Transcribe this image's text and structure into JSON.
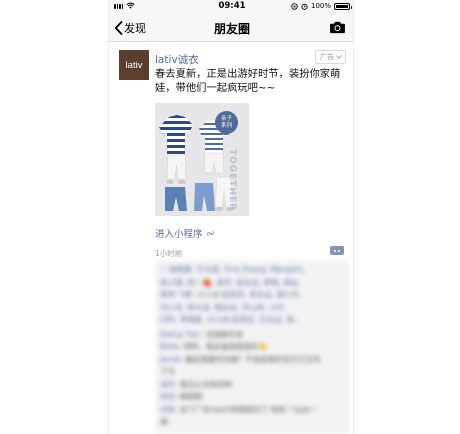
{
  "status_bar": {
    "time": "09:41",
    "battery_text": "100%",
    "battery_level": 1.0
  },
  "nav": {
    "back_label": "发现",
    "title": "朋友圈",
    "right_icon": "camera-icon"
  },
  "post": {
    "avatar_text": "lativ",
    "author": "lativ诚衣",
    "ad_label": "广告",
    "text": "春去夏新，正是出游好时节，装扮你家萌娃，带他们一起疯玩吧~~",
    "image": {
      "badge_line1": "亲子",
      "badge_line2": "系列",
      "vertical_text": "TOGETHER"
    },
    "mini_program_link": "进入小程序",
    "time": "1小时前"
  },
  "comments": {
    "likes": [
      "♡ 林晓燕, 于大成, Tina Zhang, MengXin,",
      "安小雨, 阿一🍓, 金玲, 张永远, 李晓, 胡云,",
      "周伟·飞希, 沙小朵·起宫花, 李永远, 胡小宇,",
      "刘小龙, 李大宝, 杨永远, 开心的, 小叶,",
      "CBS, 李晓星, 沙小朵·起宫花, 王永远, 我..."
    ],
    "items": [
      {
        "name": "Ewing Tian:",
        "text": "没钱换车😅"
      },
      {
        "name": "Bella:",
        "text": "呵呵，我走遍海南就好👏"
      },
      {
        "name": "Jacob:",
        "text": "确定我要的衣服？不该是真的宝贝又王吗"
      },
      {
        "name": "",
        "text": "了😊"
      },
      {
        "name": "话中:",
        "text": "我怎么也有同样"
      },
      {
        "name": "包包:",
        "text": "刷刷刷"
      },
      {
        "name": "付依:",
        "text": "这个广告reach到我就对了 哈哈 ! type !"
      },
      {
        "name": "",
        "text": "😂"
      }
    ]
  }
}
